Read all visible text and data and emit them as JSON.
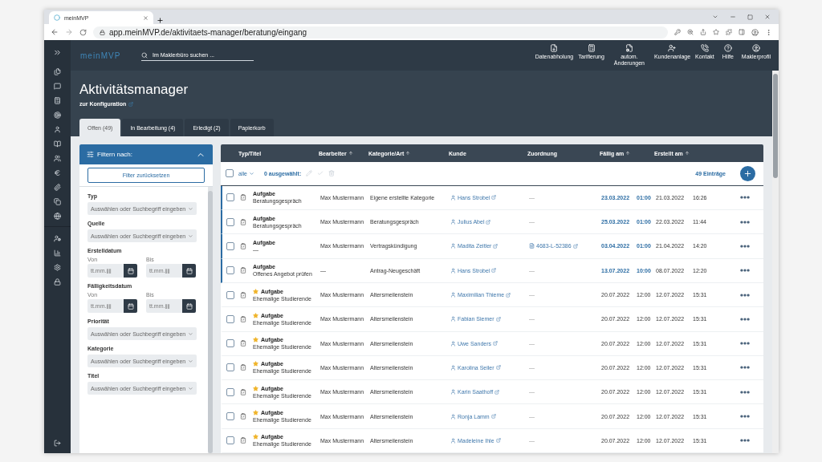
{
  "browser": {
    "tab_title": "meinMVP",
    "url": "app.meinMVP.de/aktivitaets-manager/beratung/eingang"
  },
  "header": {
    "logo": "meinMVP",
    "search_placeholder": "Im Maklerbüro suchen ...",
    "actions": [
      {
        "label": "Datenabholung"
      },
      {
        "label": "Tarifierung"
      },
      {
        "label": "autom. Änderungen"
      },
      {
        "label": "Kundenanlage"
      },
      {
        "label": "Kontakt"
      },
      {
        "label": "Hilfe"
      },
      {
        "label": "Maklerprofil"
      }
    ]
  },
  "page": {
    "title": "Aktivitätsmanager",
    "config_link": "zur Konfiguration"
  },
  "tabs": [
    {
      "label": "Offen (49)",
      "selected": true
    },
    {
      "label": "In Bearbeitung (4)",
      "selected": false
    },
    {
      "label": "Erledigt (2)",
      "selected": false
    },
    {
      "label": "Papierkorb",
      "selected": false
    }
  ],
  "filter": {
    "title": "Filtern nach:",
    "expanded": true,
    "reset": "Filter zurücksetzen",
    "fields": [
      {
        "kind": "select",
        "label": "Typ",
        "placeholder": "Auswählen oder Suchbegriff eingeben"
      },
      {
        "kind": "select",
        "label": "Quelle",
        "placeholder": "Auswählen oder Suchbegriff eingeben"
      },
      {
        "kind": "daterange",
        "label": "Erstelldatum",
        "from_label": "Von",
        "to_label": "Bis",
        "from_placeholder": "tt.mm.jjjj",
        "to_placeholder": "tt.mm.jjjj"
      },
      {
        "kind": "daterange",
        "label": "Fälligkeitsdatum",
        "from_label": "Von",
        "to_label": "Bis",
        "from_placeholder": "tt.mm.jjjj",
        "to_placeholder": "tt.mm.jjjj"
      },
      {
        "kind": "select",
        "label": "Priorität",
        "placeholder": "Auswählen oder Suchbegriff eingeben"
      },
      {
        "kind": "select",
        "label": "Kategorie",
        "placeholder": "Auswählen oder Suchbegriff eingeben"
      },
      {
        "kind": "select",
        "label": "Titel",
        "placeholder": "Auswählen oder Suchbegriff eingeben"
      }
    ]
  },
  "table": {
    "columns": [
      {
        "label": "Typ/Titel",
        "sortable": false
      },
      {
        "label": "Bearbeiter",
        "sortable": true
      },
      {
        "label": "Kategorie/Art",
        "sortable": true
      },
      {
        "label": "Kunde",
        "sortable": false
      },
      {
        "label": "Zuordnung",
        "sortable": false
      },
      {
        "label": "Fällig am",
        "sortable": true
      },
      {
        "label": "Erstellt am",
        "sortable": true
      }
    ],
    "toolbar": {
      "select_all_checked": false,
      "select_all": "alle",
      "selected_count": "0",
      "selected_label": "ausgewählt:",
      "count": "49 Einträge"
    },
    "rows": [
      {
        "checked": false,
        "highlighted": true,
        "starred": false,
        "type": "Aufgabe",
        "title": "Beratungsgespräch",
        "assignee": "Max Mustermann",
        "category": "Eigene erstellte Kategorie",
        "customer": "Hans Strobel",
        "assignment": {
          "linked": false,
          "text": "—"
        },
        "due_date": "23.03.2022",
        "due_time": "01:00",
        "created_date": "21.03.2022",
        "created_time": "16:26"
      },
      {
        "checked": false,
        "highlighted": true,
        "starred": false,
        "type": "Aufgabe",
        "title": "Beratungsgespräch",
        "assignee": "Max Mustermann",
        "category": "Beratungsgespräch",
        "customer": "Julius Abel",
        "assignment": {
          "linked": false,
          "text": "—"
        },
        "due_date": "25.03.2022",
        "due_time": "01:00",
        "created_date": "22.03.2022",
        "created_time": "11:44"
      },
      {
        "checked": false,
        "highlighted": true,
        "starred": false,
        "type": "Aufgabe",
        "title": "—",
        "assignee": "Max Mustermann",
        "category": "Vertragskündigung",
        "customer": "Madita Zeitler",
        "assignment": {
          "linked": true,
          "text": "4683-L-52386"
        },
        "due_date": "03.04.2022",
        "due_time": "01:00",
        "created_date": "21.04.2022",
        "created_time": "14:20"
      },
      {
        "checked": false,
        "highlighted": true,
        "starred": false,
        "type": "Aufgabe",
        "title": "Offenes Angebot prüfen",
        "assignee": "—",
        "category": "Antrag-Neugeschäft",
        "customer": "Hans Strobel",
        "assignment": {
          "linked": false,
          "text": "—"
        },
        "due_date": "13.07.2022",
        "due_time": "10:00",
        "created_date": "08.07.2022",
        "created_time": "12:20"
      },
      {
        "checked": false,
        "highlighted": false,
        "starred": true,
        "type": "Aufgabe",
        "title": "Ehemalige Studierende",
        "assignee": "Max Mustermann",
        "category": "Altersmeilenstein",
        "customer": "Maximilian Thieme",
        "assignment": {
          "linked": false,
          "text": "—"
        },
        "due_date": "20.07.2022",
        "due_time": "12:00",
        "created_date": "12.07.2022",
        "created_time": "15:31"
      },
      {
        "checked": false,
        "highlighted": false,
        "starred": true,
        "type": "Aufgabe",
        "title": "Ehemalige Studierende",
        "assignee": "Max Mustermann",
        "category": "Altersmeilenstein",
        "customer": "Fabian Siemer",
        "assignment": {
          "linked": false,
          "text": "—"
        },
        "due_date": "20.07.2022",
        "due_time": "12:00",
        "created_date": "12.07.2022",
        "created_time": "15:31"
      },
      {
        "checked": false,
        "highlighted": false,
        "starred": true,
        "type": "Aufgabe",
        "title": "Ehemalige Studierende",
        "assignee": "Max Mustermann",
        "category": "Altersmeilenstein",
        "customer": "Uwe Sanders",
        "assignment": {
          "linked": false,
          "text": "—"
        },
        "due_date": "20.07.2022",
        "due_time": "12:00",
        "created_date": "12.07.2022",
        "created_time": "15:31"
      },
      {
        "checked": false,
        "highlighted": false,
        "starred": true,
        "type": "Aufgabe",
        "title": "Ehemalige Studierende",
        "assignee": "Max Mustermann",
        "category": "Altersmeilenstein",
        "customer": "Karolina Seiler",
        "assignment": {
          "linked": false,
          "text": "—"
        },
        "due_date": "20.07.2022",
        "due_time": "12:00",
        "created_date": "12.07.2022",
        "created_time": "15:31"
      },
      {
        "checked": false,
        "highlighted": false,
        "starred": true,
        "type": "Aufgabe",
        "title": "Ehemalige Studierende",
        "assignee": "Max Mustermann",
        "category": "Altersmeilenstein",
        "customer": "Karin Saathoff",
        "assignment": {
          "linked": false,
          "text": "—"
        },
        "due_date": "20.07.2022",
        "due_time": "12:00",
        "created_date": "12.07.2022",
        "created_time": "15:31"
      },
      {
        "checked": false,
        "highlighted": false,
        "starred": true,
        "type": "Aufgabe",
        "title": "Ehemalige Studierende",
        "assignee": "Max Mustermann",
        "category": "Altersmeilenstein",
        "customer": "Ronja Lamm",
        "assignment": {
          "linked": false,
          "text": "—"
        },
        "due_date": "20.07.2022",
        "due_time": "12:00",
        "created_date": "12.07.2022",
        "created_time": "15:31"
      },
      {
        "checked": false,
        "highlighted": false,
        "starred": true,
        "type": "Aufgabe",
        "title": "Ehemalige Studierende",
        "assignee": "Max Mustermann",
        "category": "Altersmeilenstein",
        "customer": "Madeleine Ihle",
        "assignment": {
          "linked": false,
          "text": "—"
        },
        "due_date": "20.07.2022",
        "due_time": "12:00",
        "created_date": "12.07.2022",
        "created_time": "15:31"
      }
    ]
  }
}
